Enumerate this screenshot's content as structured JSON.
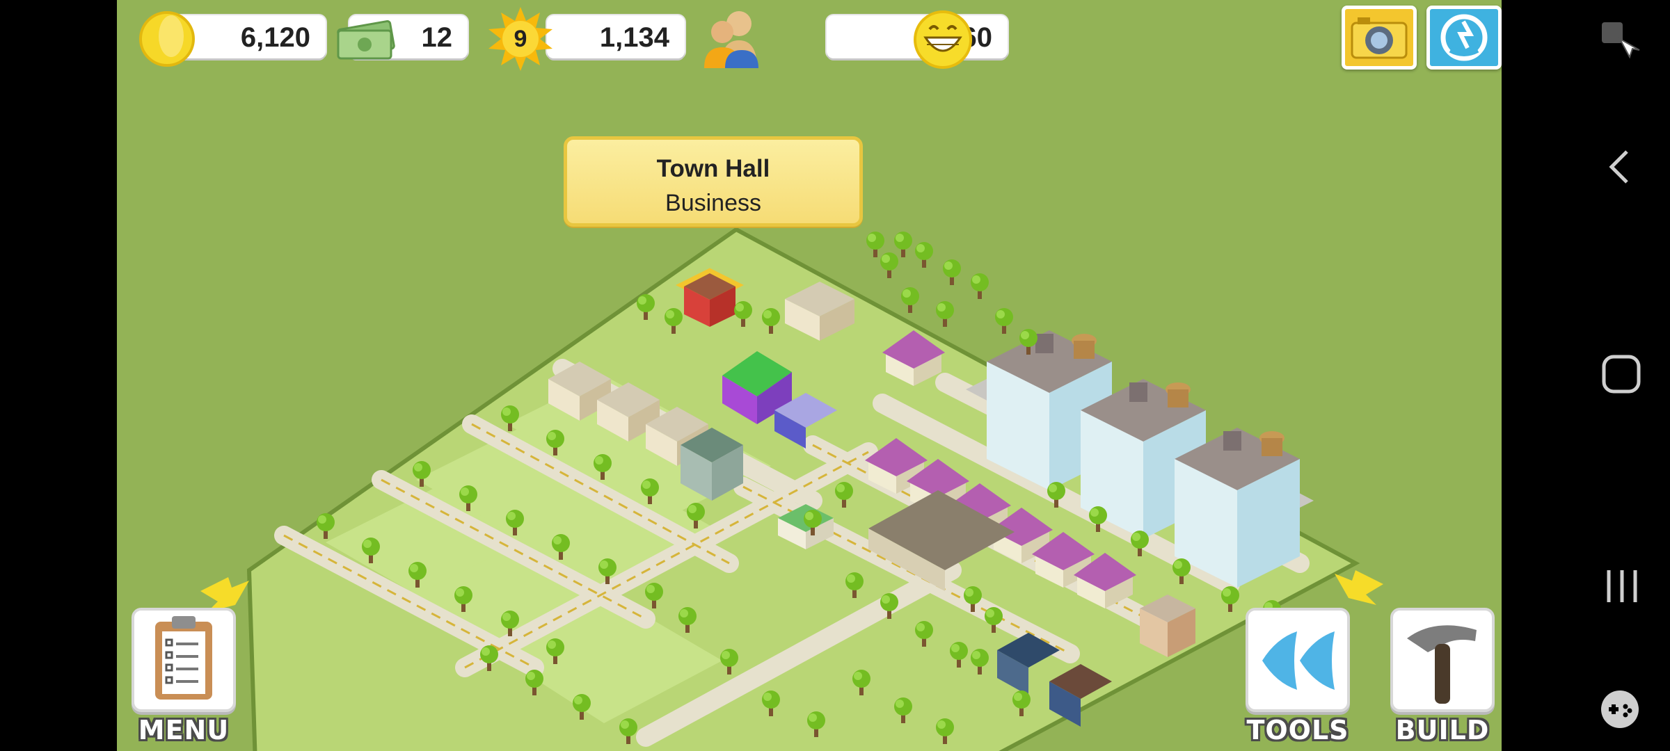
{
  "hud": {
    "coins": "6,120",
    "cash": "12",
    "level": "9",
    "xp": "1,134",
    "population": "1,360",
    "happiness_icon": "smiley-face-icon"
  },
  "tooltip": {
    "title": "Town Hall",
    "subtitle": "Business"
  },
  "buttons": {
    "menu": "MENU",
    "tools": "TOOLS",
    "build": "BUILD",
    "camera_icon": "camera-icon",
    "share_icon": "share-icon"
  },
  "navbar": {
    "icons": [
      "screen-rotate-icon",
      "back-icon",
      "home-icon",
      "recents-icon",
      "game-tools-icon"
    ]
  },
  "colors": {
    "grass": "#93b356",
    "tooltip": "#f6dc75",
    "share_button": "#3fb2e0",
    "camera_button": "#f3c62e"
  }
}
